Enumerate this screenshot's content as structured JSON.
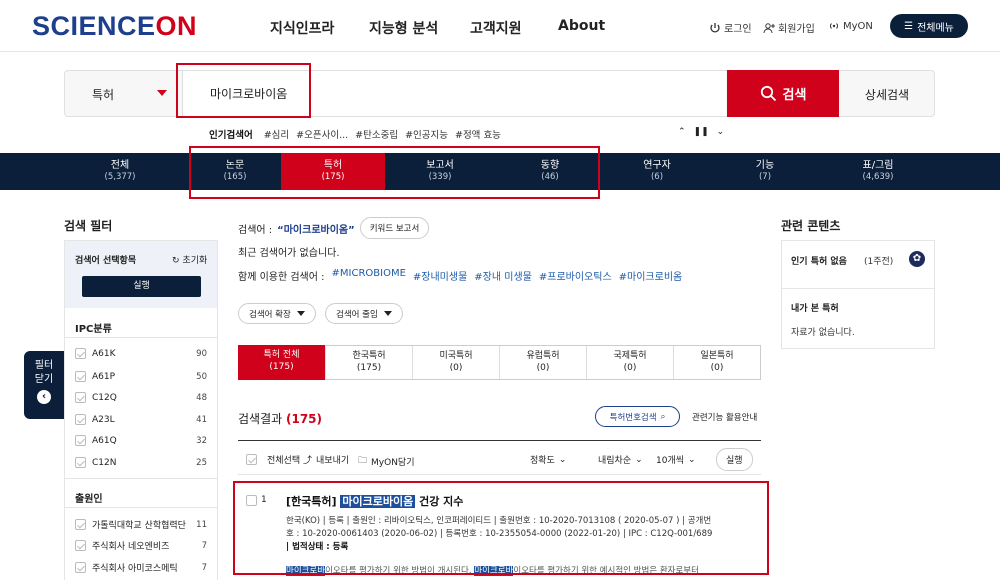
{
  "header": {
    "logo_text": "SCIENCE",
    "logo_on": "ON",
    "nav": [
      "지식인프라",
      "지능형 분석",
      "고객지원",
      "About"
    ],
    "util": {
      "login": "로그인",
      "signup": "회원가입",
      "myon": "MyON"
    },
    "all_menu": "전체메뉴"
  },
  "search": {
    "category": "특허",
    "query": "마이크로바이옴",
    "button": "검색",
    "advanced": "상세검색"
  },
  "popular": {
    "label": "인기검색어",
    "terms": [
      "#심리",
      "#오픈사이...",
      "#탄소중립",
      "#인공지능",
      "#정액 효능"
    ]
  },
  "tabs": [
    {
      "label": "전체",
      "count": "(5,377)"
    },
    {
      "label": "논문",
      "count": "(165)"
    },
    {
      "label": "특허",
      "count": "(175)"
    },
    {
      "label": "보고서",
      "count": "(339)"
    },
    {
      "label": "동향",
      "count": "(46)"
    },
    {
      "label": "연구자",
      "count": "(6)"
    },
    {
      "label": "기능",
      "count": "(7)"
    },
    {
      "label": "표/그림",
      "count": "(4,639)"
    }
  ],
  "filter": {
    "title": "검색 필터",
    "select_label": "검색어 선택항목",
    "reset": "초기화",
    "run": "실행",
    "toggle_label_1": "필터",
    "toggle_label_2": "닫기",
    "ipc_title": "IPC분류",
    "ipc": [
      {
        "code": "A61K",
        "n": "90"
      },
      {
        "code": "A61P",
        "n": "50"
      },
      {
        "code": "C12Q",
        "n": "48"
      },
      {
        "code": "A23L",
        "n": "41"
      },
      {
        "code": "A61Q",
        "n": "32"
      },
      {
        "code": "C12N",
        "n": "25"
      }
    ],
    "applicant_title": "출원인",
    "applicants": [
      {
        "name": "가톨릭대학교 산학협력단",
        "n": "11"
      },
      {
        "name": "주식회사 네오엔비즈",
        "n": "7"
      },
      {
        "name": "주식회사 아미코스메틱",
        "n": "7"
      }
    ]
  },
  "keyword": {
    "label": "검색어 :",
    "query": "“마이크로바이옴”",
    "report_btn": "키워드 보고서",
    "recent": "최근 검색어가 없습니다.",
    "together_label": "함께 이용한 검색어 :",
    "together": [
      "#MICROBIOME",
      "#장내미생물",
      "#장내 미생물",
      "#프로바이오틱스",
      "#마이크로비옴"
    ],
    "expand": "검색어 확장",
    "reduce": "검색어 줄임"
  },
  "subtabs": [
    {
      "label": "특허 전체",
      "count": "(175)"
    },
    {
      "label": "한국특허",
      "count": "(175)"
    },
    {
      "label": "미국특허",
      "count": "(0)"
    },
    {
      "label": "유럽특허",
      "count": "(0)"
    },
    {
      "label": "국제특허",
      "count": "(0)"
    },
    {
      "label": "일본특허",
      "count": "(0)"
    }
  ],
  "results": {
    "title": "검색결과",
    "count": "(175)",
    "patent_search": "특허번호검색",
    "guide": "관련기능 활용안내",
    "select_all": "전체선택",
    "export": "내보내기",
    "myon": "MyON담기",
    "sort": "정확도",
    "order": "내림차순",
    "per_page": "10개씩",
    "run": "실행",
    "item": {
      "num": "1",
      "prefix": "[한국특허]",
      "hl": "마이크로바이옴",
      "suffix": "건강 지수",
      "meta1": "한국(KO) | 등록 | 출원인 : 리바이오틱스, 인코퍼레이티드 | 출원번호 : 10-2020-7013108 ( 2020-05-07 ) | 공개번",
      "meta2": "호 : 10-2020-0061403 (2020-06-02) | 등록번호 : 10-2355054-0000 (2022-01-20) | IPC : C12Q-001/689",
      "status": "| 법적상태 : 등록",
      "snippet": "마이크로바이오타를 평가하기 위한 방법이 개시된다. 마이크로바이오타를 평가하기 위한 예시적인 방법은 환자로부터"
    }
  },
  "related": {
    "title": "관련 콘텐츠",
    "popular": "인기 특허 없음",
    "period": "(1주전)",
    "viewed_title": "내가 본 특허",
    "viewed_empty": "자료가 없습니다."
  }
}
